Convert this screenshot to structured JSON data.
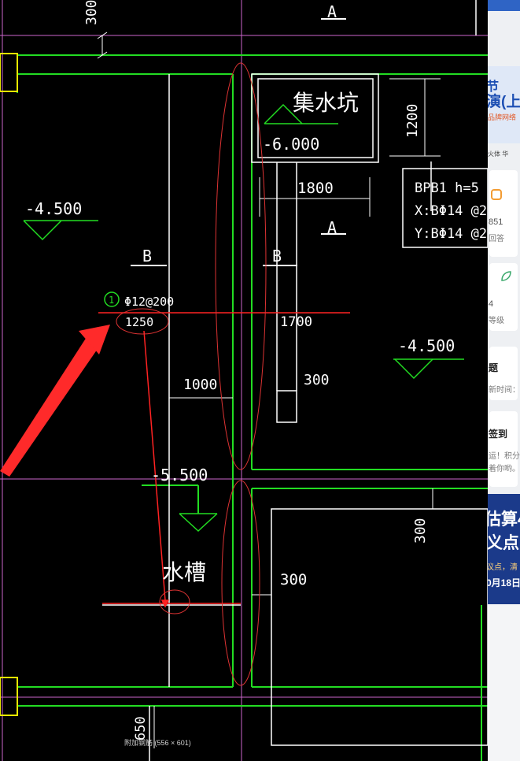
{
  "drawing": {
    "labels": {
      "dim_300_top": "300",
      "section_a_top": "A",
      "sump_title": "集水坑",
      "sump_elev": "-6.000",
      "dim_1200": "1200",
      "dim_1800": "1800",
      "section_a_mid": "A",
      "plate_line1": "BPB1 h=5",
      "plate_line2": "X:BΦ14 @2",
      "plate_line3": "Y:BΦ14 @2",
      "elev_left": "-4.500",
      "section_b_left": "B",
      "section_b_mid": "B",
      "rebar_mark": "1",
      "rebar_spec": "Φ12@200",
      "rebar_length": "1250",
      "dim_1700": "1700",
      "elev_right": "-4.500",
      "dim_1000": "1000",
      "dim_300_mid": "300",
      "elev_trough": "-5.500",
      "trough_title": "水槽",
      "dim_300_right": "300",
      "dim_300_low": "300",
      "dim_650": "650"
    },
    "caption": "附加钢筋 (556 × 601)"
  },
  "side_panel": {
    "banner_line1": "节",
    "banner_line2": "演(上",
    "banner_line3": "品牌网络",
    "banner_sub": "火体 华",
    "stat_count": "851",
    "stat_count_label": "回答",
    "stat_level": "4",
    "stat_level_label": "等级",
    "section_text": "题",
    "section_time": "新时间：",
    "checkin_title": "签到",
    "checkin_line1": "运！积分",
    "checkin_line2": "着你哟。",
    "ad_line1": "估算4",
    "ad_line2": "义点",
    "ad_line3": "议点，清",
    "ad_line4": "0月18日"
  },
  "colors": {
    "wall_green": "#22dd22",
    "axis_magenta": "#cc66cc",
    "line_white": "#ffffff",
    "highlight_red": "#ff2222",
    "axis_yellow": "#e8e800"
  }
}
